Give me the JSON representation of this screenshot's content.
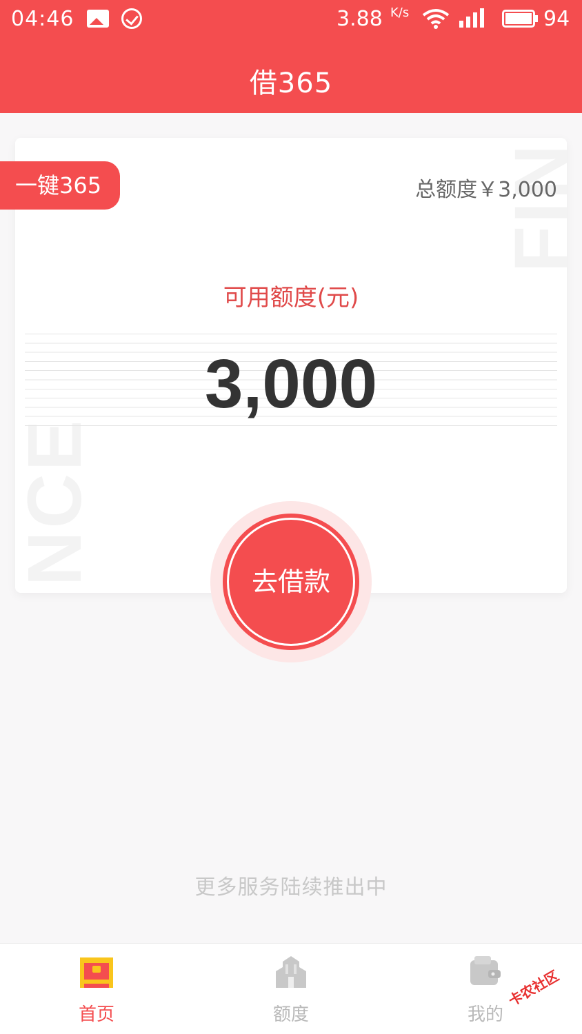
{
  "status_bar": {
    "time": "04:46",
    "speed": "3.88",
    "speed_unit": "K/s",
    "battery_level": "94",
    "icons": [
      "gallery-icon",
      "check-circle-icon",
      "wifi-icon",
      "signal-4g-icon",
      "battery-icon"
    ]
  },
  "header": {
    "title": "借365"
  },
  "card": {
    "tag_label": "一键365",
    "total_limit": "总额度￥3,000",
    "available_label": "可用额度(元)",
    "available_amount": "3,000",
    "watermark_top": "FINA",
    "watermark_bottom": "NCE"
  },
  "borrow_button": {
    "label": "去借款"
  },
  "footer_note": "更多服务陆续推出中",
  "tabbar": {
    "items": [
      {
        "label": "首页",
        "icon": "home-chest-icon",
        "active": true
      },
      {
        "label": "额度",
        "icon": "building-icon",
        "active": false
      },
      {
        "label": "我的",
        "icon": "wallet-icon",
        "active": false
      }
    ]
  },
  "logo": {
    "text": "卡农社区"
  },
  "colors": {
    "primary": "#f44d4f",
    "amount_text": "#333333",
    "inactive_tab": "#b9b9b9"
  }
}
